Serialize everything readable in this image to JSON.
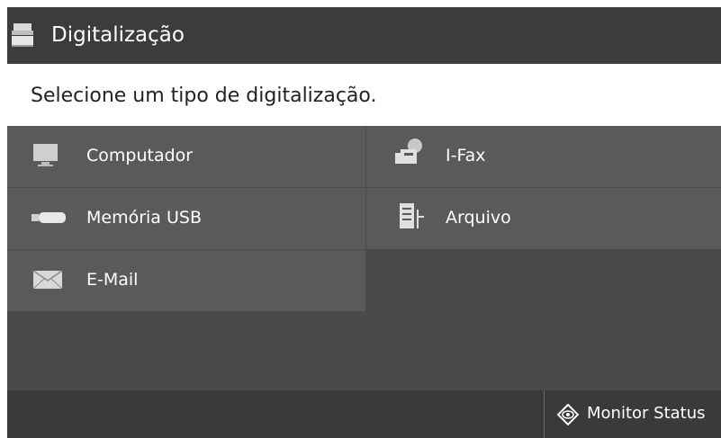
{
  "header": {
    "title": "Digitalização",
    "icon": "scan-document-icon"
  },
  "prompt": {
    "text": "Selecione um tipo de digitalização."
  },
  "options": {
    "computer": {
      "label": "Computador",
      "icon": "monitor-icon"
    },
    "ifax": {
      "label": "I-Fax",
      "icon": "internet-fax-icon"
    },
    "usb": {
      "label": "Memória USB",
      "icon": "usb-drive-icon"
    },
    "file": {
      "label": "Arquivo",
      "icon": "file-server-icon"
    },
    "email": {
      "label": "E-Mail",
      "icon": "envelope-icon"
    }
  },
  "status": {
    "label": "Monitor Status",
    "icon": "status-monitor-icon"
  },
  "colors": {
    "titlebar": "#3c3c3c",
    "tile": "#5a5a5a",
    "background": "#4a4a4a",
    "statusbar": "#3a3a3a",
    "text": "#ffffff"
  }
}
